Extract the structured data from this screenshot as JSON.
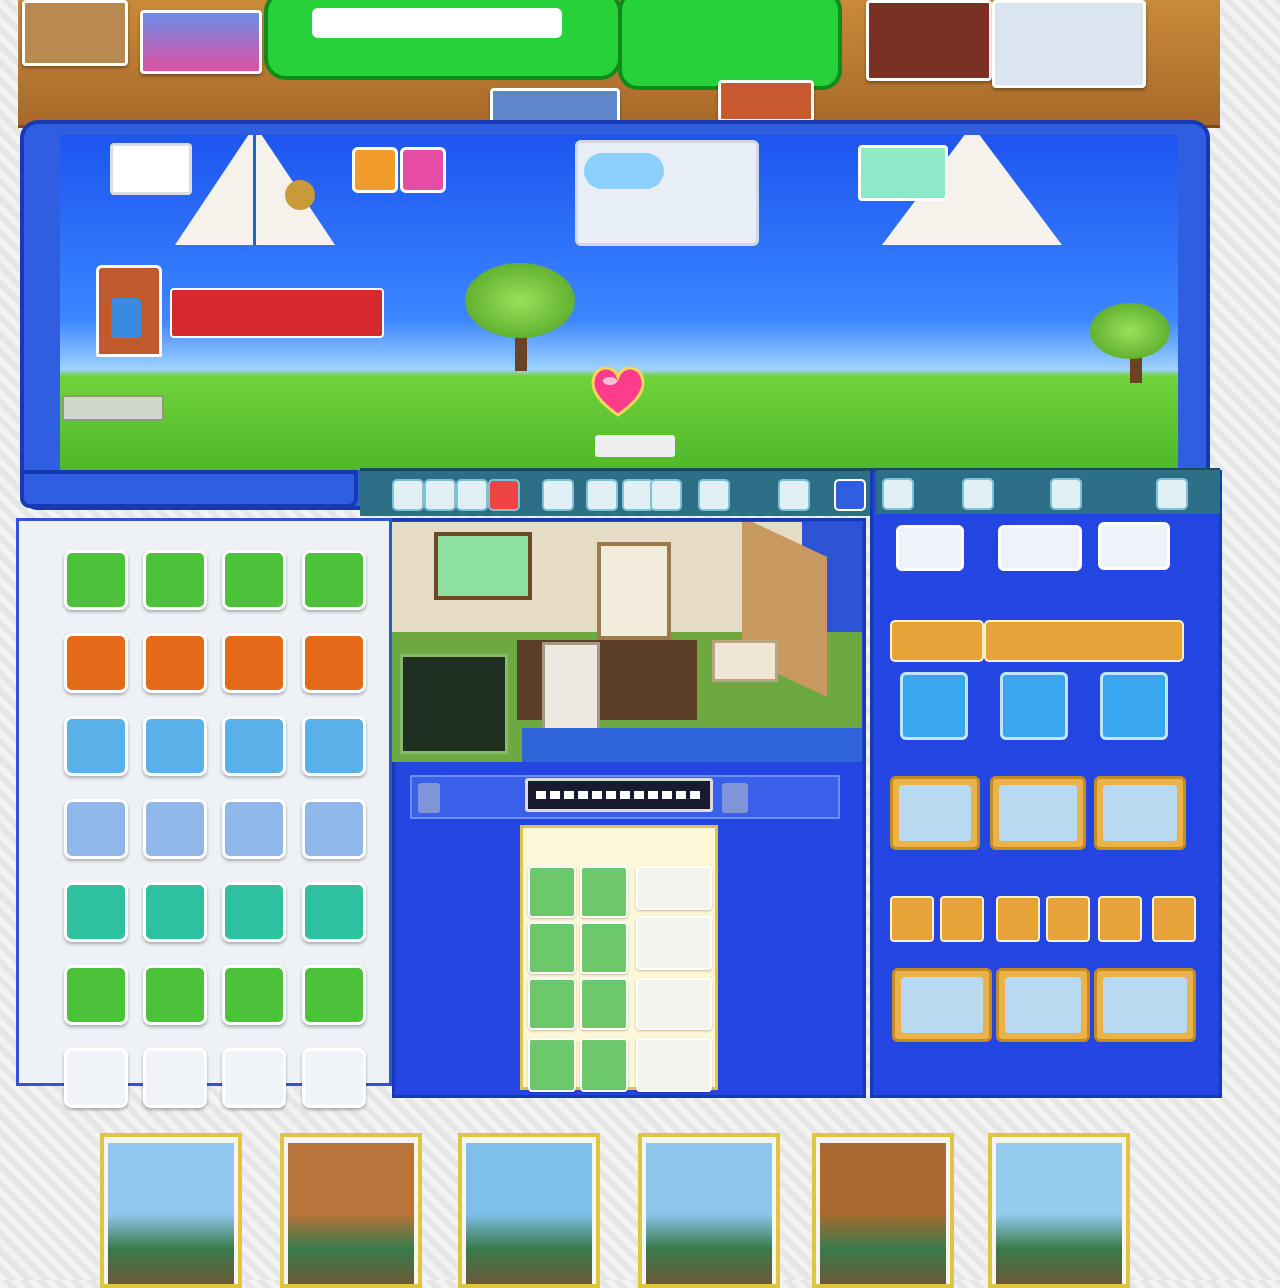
{
  "scene": {
    "banner_label": "",
    "heart_caption": ""
  },
  "colors": {
    "sky": "#1d55f0",
    "grass": "#4fb82a",
    "panel_blue": "#2346e2",
    "frame_blue": "#1839b4",
    "toolbar_teal": "#2d6f86",
    "accent_orange": "#e8a23a",
    "accent_green": "#27d13a",
    "banner_red": "#d6292e"
  },
  "icons": {
    "heart": "heart-icon",
    "tree": "tree-icon",
    "sail": "sailboat-icon",
    "house": "house-icon"
  },
  "toolbar": {
    "buttons": [
      "tool-1",
      "tool-2",
      "tool-3",
      "tool-4",
      "tool-5",
      "tool-6",
      "tool-7",
      "tool-8",
      "tool-9",
      "tool-10"
    ]
  },
  "left_grid": {
    "rows": 7,
    "cols": 4,
    "row_colors": [
      "#4cc23a",
      "#e46a1a",
      "#5ab0e8",
      "#8fb7e8",
      "#2fc0a0",
      "#4cc23a",
      "#f0f4f8"
    ]
  },
  "right_panel": {
    "tiles": 3,
    "cards_row1": 3,
    "small_items": 6,
    "cards_row3": 3
  },
  "postcards": {
    "count": 6,
    "tones": [
      "#8fc8ee",
      "#b8743a",
      "#7ec0ea",
      "#8cc6ec",
      "#a86a30",
      "#92cdf0"
    ]
  }
}
